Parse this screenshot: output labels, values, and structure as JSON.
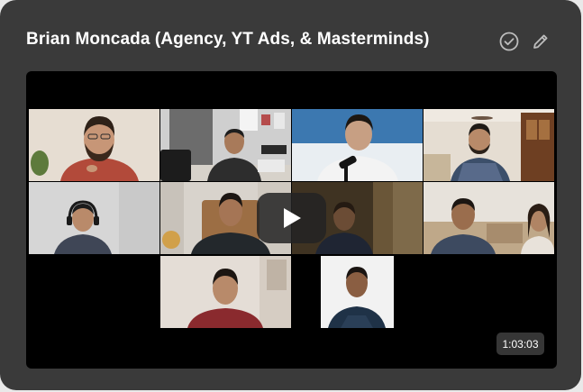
{
  "video": {
    "title": "Brian Moncada (Agency, YT Ads, & Masterminds)",
    "duration": "1:03:03"
  },
  "icons": {
    "approve": "check-circle-icon",
    "edit": "pencil-icon",
    "play": "play-icon"
  },
  "colors": {
    "card_background": "#3a3a3a",
    "player_background": "#000000",
    "title_text": "#ffffff",
    "icon_stroke": "#bdbdbd"
  }
}
